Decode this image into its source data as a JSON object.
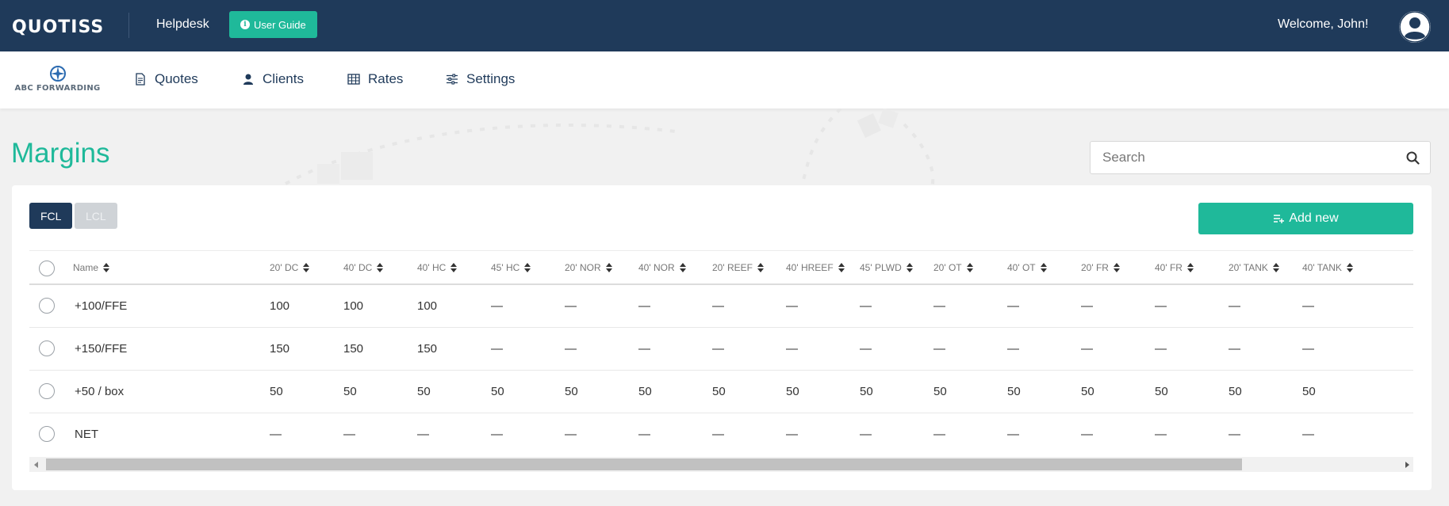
{
  "header": {
    "logo": "QUOTISS",
    "helpdesk": "Helpdesk",
    "user_guide": "User Guide",
    "welcome": "Welcome, John!"
  },
  "nav": {
    "brand": "ABC FORWARDING",
    "items": [
      {
        "label": "Quotes",
        "icon": "document-icon"
      },
      {
        "label": "Clients",
        "icon": "user-icon"
      },
      {
        "label": "Rates",
        "icon": "table-icon"
      },
      {
        "label": "Settings",
        "icon": "sliders-icon"
      }
    ]
  },
  "page": {
    "title": "Margins",
    "search_placeholder": "Search"
  },
  "tabs": [
    {
      "label": "FCL",
      "active": true
    },
    {
      "label": "LCL",
      "active": false
    }
  ],
  "add_new": "Add new",
  "table": {
    "columns": [
      "Name",
      "20' DC",
      "40' DC",
      "40' HC",
      "45' HC",
      "20' NOR",
      "40' NOR",
      "20' REEF",
      "40' HREEF",
      "45' PLWD",
      "20' OT",
      "40' OT",
      "20' FR",
      "40' FR",
      "20' TANK",
      "40' TANK"
    ],
    "rows": [
      [
        "+100/FFE",
        "100",
        "100",
        "100",
        "—",
        "—",
        "—",
        "—",
        "—",
        "—",
        "—",
        "—",
        "—",
        "—",
        "—",
        "—"
      ],
      [
        "+150/FFE",
        "150",
        "150",
        "150",
        "—",
        "—",
        "—",
        "—",
        "—",
        "—",
        "—",
        "—",
        "—",
        "—",
        "—",
        "—"
      ],
      [
        "+50 / box",
        "50",
        "50",
        "50",
        "50",
        "50",
        "50",
        "50",
        "50",
        "50",
        "50",
        "50",
        "50",
        "50",
        "50",
        "50"
      ],
      [
        "NET",
        "—",
        "—",
        "—",
        "—",
        "—",
        "—",
        "—",
        "—",
        "—",
        "—",
        "—",
        "—",
        "—",
        "—",
        "—"
      ]
    ]
  },
  "colors": {
    "header_bg": "#1f3a5a",
    "accent": "#1fb99a",
    "tab_active": "#1f3a5a",
    "tab_inactive": "#cfd3d7"
  }
}
